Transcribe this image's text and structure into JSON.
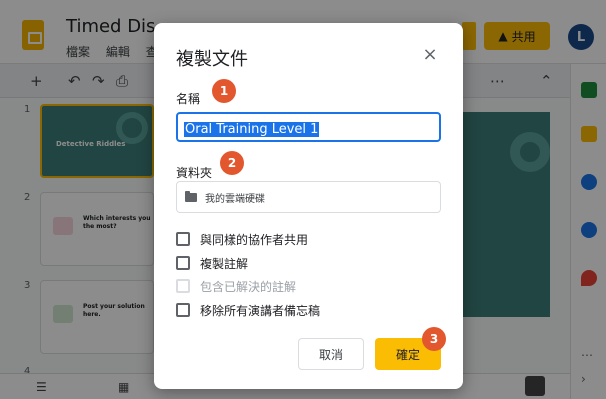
{
  "header": {
    "doc_title": "Timed Dis...",
    "menu": [
      "檔案",
      "編輯",
      "查看"
    ],
    "share_label": "共用",
    "avatar_initial": "L"
  },
  "filmstrip": {
    "slides": [
      {
        "number": "1",
        "title": "Detective Riddles"
      },
      {
        "number": "2",
        "title": "Which interests you the most?"
      },
      {
        "number": "3",
        "title": "Post your solution here."
      },
      {
        "number": "4",
        "title": ""
      }
    ]
  },
  "dialog": {
    "title": "複製文件",
    "name_label": "名稱",
    "name_value": "Oral Training Level 1",
    "folder_label": "資料夾",
    "folder_value": "我的雲端硬碟",
    "checkboxes": [
      {
        "label": "與同樣的協作者共用",
        "checked": false,
        "disabled": false
      },
      {
        "label": "複製註解",
        "checked": false,
        "disabled": false
      },
      {
        "label": "包含已解決的註解",
        "checked": false,
        "disabled": true
      },
      {
        "label": "移除所有演講者備忘稿",
        "checked": false,
        "disabled": false
      }
    ],
    "cancel_label": "取消",
    "ok_label": "確定",
    "close_symbol": "×"
  },
  "badges": [
    "1",
    "2",
    "3"
  ],
  "colors": {
    "accent": "#fbbc04",
    "focus": "#1a73e8",
    "badge": "#e2572d",
    "slide_bg": "#3d7e78"
  }
}
